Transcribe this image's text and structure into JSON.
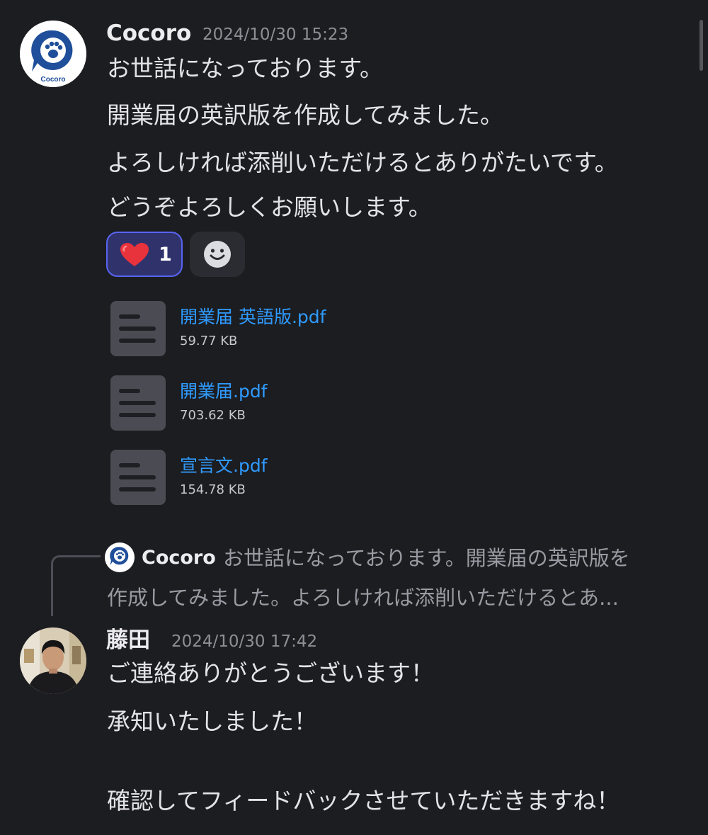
{
  "colors": {
    "background": "#1c1d21",
    "link": "#2f9bff",
    "reaction_active_bg": "#30336b",
    "reaction_active_border": "#5865f2",
    "muted_text": "#8e8f96"
  },
  "message1": {
    "author": "Cocoro",
    "avatar_label": "Cocoro",
    "timestamp": "2024/10/30 15:23",
    "lines": [
      "お世話になっております。",
      "開業届の英訳版を作成してみました。",
      "よろしければ添削いただけるとありがたいです。",
      "どうぞよろしくお願いします。"
    ],
    "reactions": [
      {
        "emoji": "heart",
        "count": "1",
        "active": true
      }
    ],
    "add_reaction_icon": "smiley-add-reaction-icon",
    "attachments": [
      {
        "name": "開業届 英語版.pdf",
        "size": "59.77 KB",
        "icon": "document-file-icon"
      },
      {
        "name": "開業届.pdf",
        "size": "703.62 KB",
        "icon": "document-file-icon"
      },
      {
        "name": "宣言文.pdf",
        "size": "154.78 KB",
        "icon": "document-file-icon"
      }
    ]
  },
  "reply_reference": {
    "author": "Cocoro",
    "preview_line1": "お世話になっております。開業届の英訳版を",
    "preview_line2": "作成してみました。よろしければ添削いただけるとあ..."
  },
  "message2": {
    "author": "藤田",
    "timestamp": "2024/10/30 17:42",
    "lines": [
      "ご連絡ありがとうございます！",
      "承知いたしました！",
      "確認してフィードバックさせていただきますね！"
    ]
  }
}
